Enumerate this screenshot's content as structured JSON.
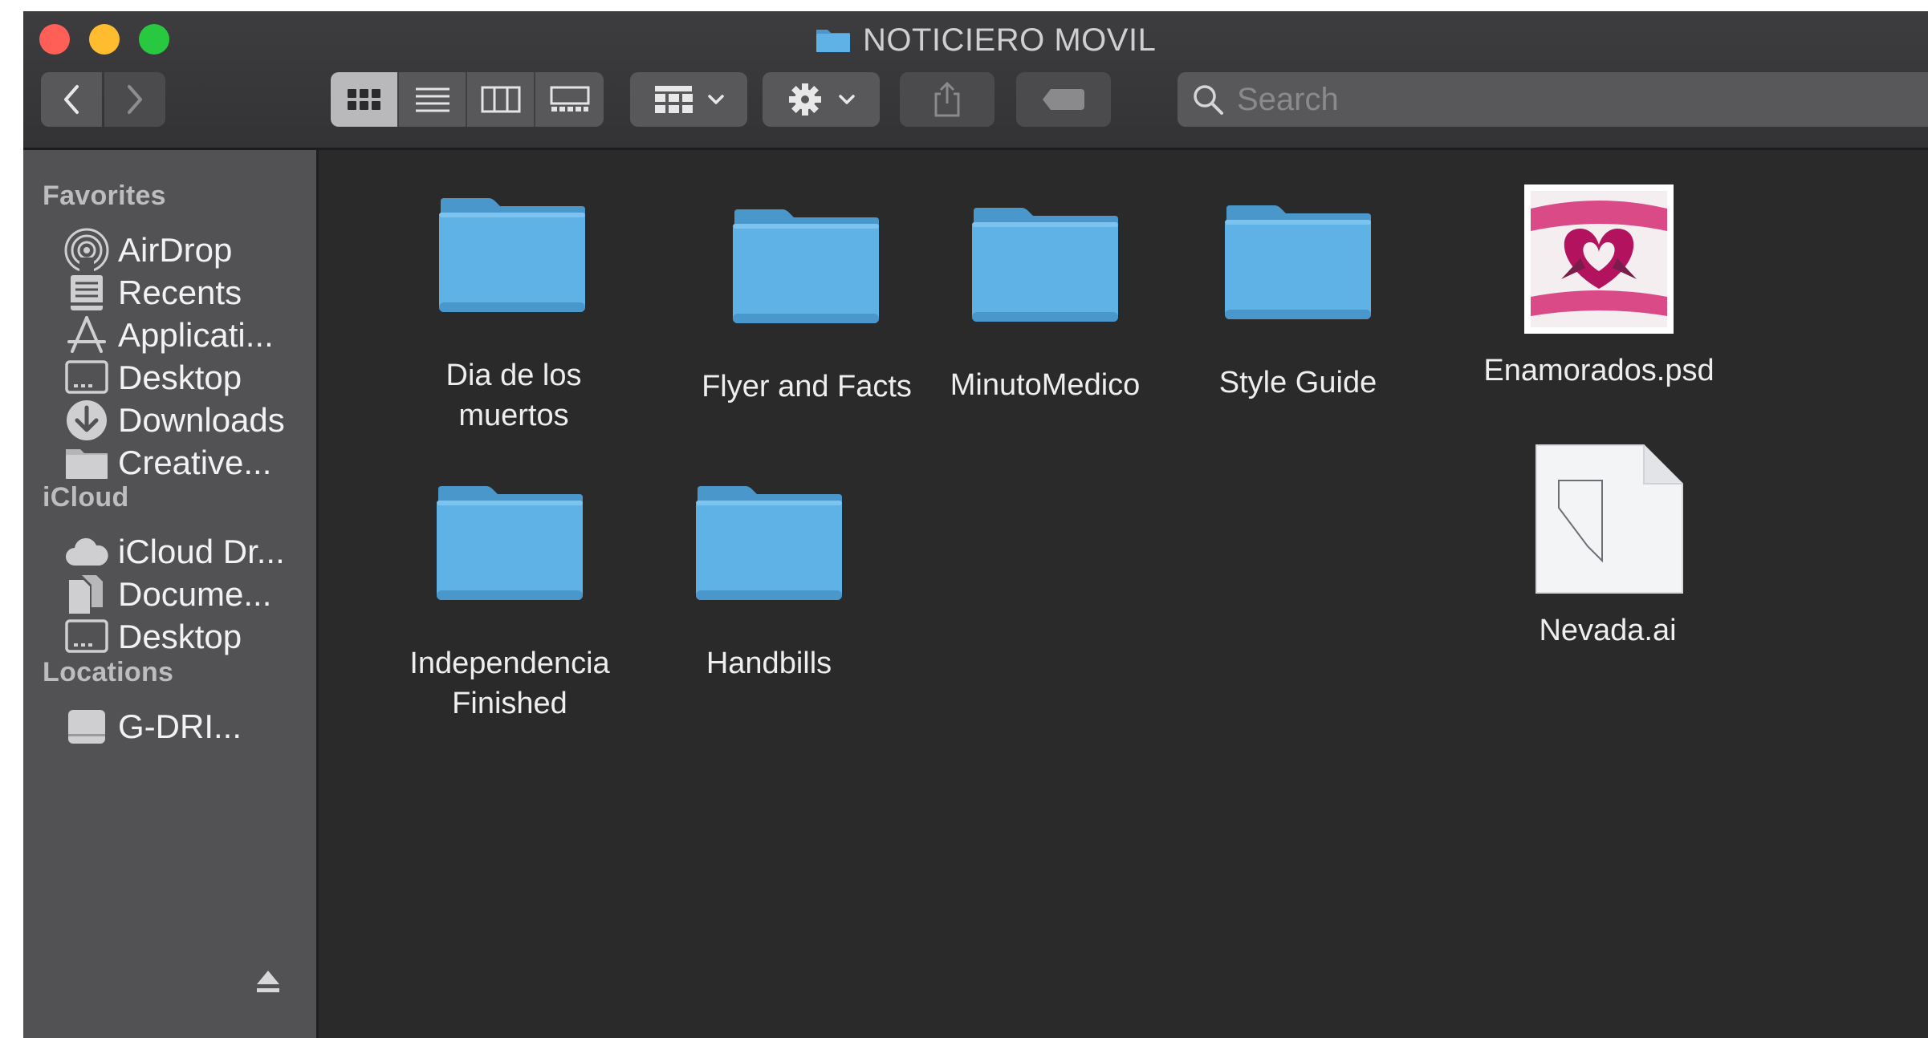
{
  "window": {
    "title": "NOTICIERO MOVIL"
  },
  "search": {
    "placeholder": "Search"
  },
  "sidebar": {
    "sections": {
      "favorites": "Favorites",
      "icloud": "iCloud",
      "locations": "Locations"
    },
    "items": [
      {
        "label": "AirDrop",
        "icon": "airdrop-icon"
      },
      {
        "label": "Recents",
        "icon": "recents-icon"
      },
      {
        "label": "Applicati...",
        "icon": "applications-icon"
      },
      {
        "label": "Desktop",
        "icon": "desktop-icon"
      },
      {
        "label": "Downloads",
        "icon": "downloads-icon"
      },
      {
        "label": "Creative...",
        "icon": "folder-icon"
      },
      {
        "label": "iCloud Dr...",
        "icon": "cloud-icon"
      },
      {
        "label": "Docume...",
        "icon": "documents-icon"
      },
      {
        "label": "Desktop",
        "icon": "desktop-icon"
      },
      {
        "label": "G-DRI...",
        "icon": "drive-icon"
      }
    ]
  },
  "files": [
    {
      "line1": "Dia de los",
      "line2": "muertos",
      "kind": "folder"
    },
    {
      "line1": "Flyer and Facts",
      "line2": "",
      "kind": "folder"
    },
    {
      "line1": "MinutoMedico",
      "line2": "",
      "kind": "folder"
    },
    {
      "line1": "Style Guide",
      "line2": "",
      "kind": "folder"
    },
    {
      "line1": "Enamorados.psd",
      "line2": "",
      "kind": "psd-thumbnail"
    },
    {
      "line1": "Independencia",
      "line2": "Finished",
      "kind": "folder"
    },
    {
      "line1": "Handbills",
      "line2": "",
      "kind": "folder"
    },
    {
      "line1": "Nevada.ai",
      "line2": "",
      "kind": "ai-document"
    }
  ],
  "colors": {
    "folder": "#5fb2e6",
    "folder_dark": "#4a97cc",
    "window_bg": "#2a2a2b",
    "sidebar_bg": "#525255",
    "close": "#ff5f57",
    "minimize": "#febc2e",
    "zoom": "#28c840"
  }
}
